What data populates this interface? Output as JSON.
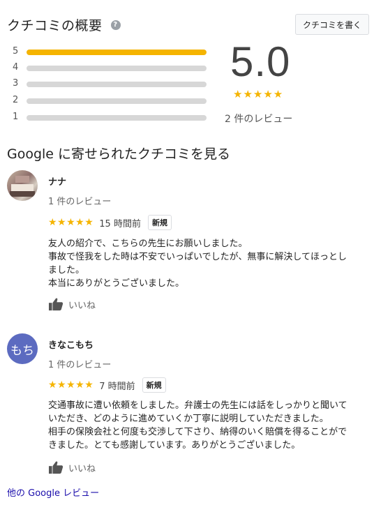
{
  "summary": {
    "title": "クチコミの概要",
    "help_icon": "help-icon",
    "write_review_label": "クチコミを書く",
    "histogram": [
      {
        "star": "5",
        "fraction": 1.0
      },
      {
        "star": "4",
        "fraction": 0
      },
      {
        "star": "3",
        "fraction": 0
      },
      {
        "star": "2",
        "fraction": 0
      },
      {
        "star": "1",
        "fraction": 0
      }
    ],
    "score": "5.0",
    "score_stars": "★★★★★",
    "review_total": "2 件のレビュー"
  },
  "section_heading": "Google に寄せられたクチコミを見る",
  "reviews": [
    {
      "name": "ナナ",
      "avatar_text": "",
      "review_count": "1 件のレビュー",
      "stars": "★★★★★",
      "time_ago": "15 時間前",
      "badge": "新規",
      "text": "友人の紹介で、こちらの先生にお願いしました。\n事故で怪我をした時は不安でいっぱいでしたが、無事に解決してほっとし\nました。\n本当にありがとうございました。",
      "like_label": "いいね"
    },
    {
      "name": "きなこもち",
      "avatar_text": "もち",
      "review_count": "1 件のレビュー",
      "stars": "★★★★★",
      "time_ago": "7 時間前",
      "badge": "新規",
      "text": "交通事故に遭い依頼をしました。弁護士の先生には話をしっかりと聞いて\nいただき、どのように進めていくか丁寧に説明していただきました。\n相手の保険会社と何度も交渉して下さり、納得のいく賠償を得ることがで\nきました。とても感謝しています。ありがとうございました。",
      "like_label": "いいね"
    }
  ],
  "more_reviews_label": "他の Google レビュー",
  "colors": {
    "star": "#f5b400",
    "bar_empty": "#d7d7d7",
    "link": "#1a0dab",
    "avatar_bg": "#5c6bc0"
  }
}
